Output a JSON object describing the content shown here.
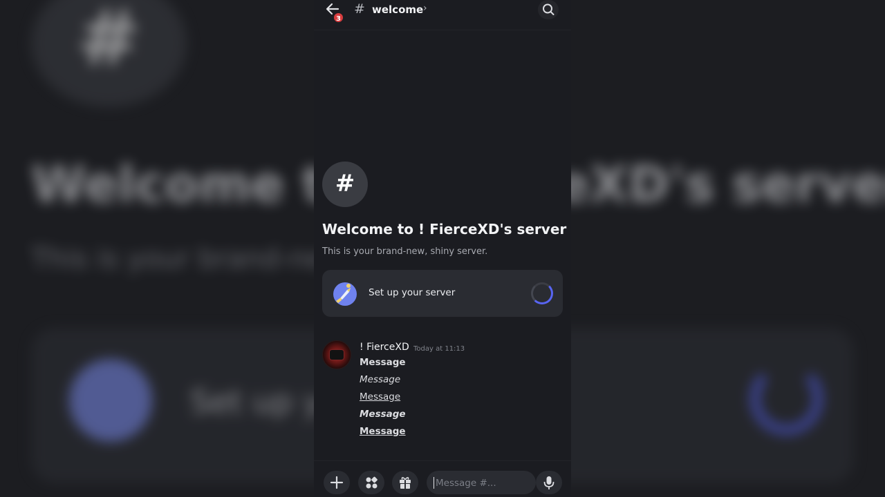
{
  "backdrop": {
    "hash": "#",
    "title": "Welcome to ! FierceXD's server",
    "subtitle": "This is your brand-new, shiny server.",
    "card_text": "Set up your server"
  },
  "header": {
    "back_badge": "3",
    "channel_hash": "#",
    "channel_name": "welcome",
    "chevron": "›"
  },
  "intro": {
    "icon": "#",
    "title": "Welcome to ! FierceXD's server",
    "subtitle": "This is your brand-new, shiny server."
  },
  "setup_card": {
    "label": "Set up your server"
  },
  "message": {
    "author": "! FierceXD",
    "timestamp": "Today at 11:13",
    "lines": [
      "Message",
      "Message",
      "Message",
      "Message",
      "Message"
    ]
  },
  "composer": {
    "placeholder": "Message #..."
  },
  "colors": {
    "accent": "#5865f2",
    "badge": "#d83c3e",
    "background": "#1b1c21",
    "card": "#2a2c32"
  },
  "icons": [
    "back-arrow-icon",
    "search-icon",
    "hash-icon",
    "plus-icon",
    "apps-icon",
    "gift-icon",
    "emoji-icon",
    "microphone-icon"
  ]
}
